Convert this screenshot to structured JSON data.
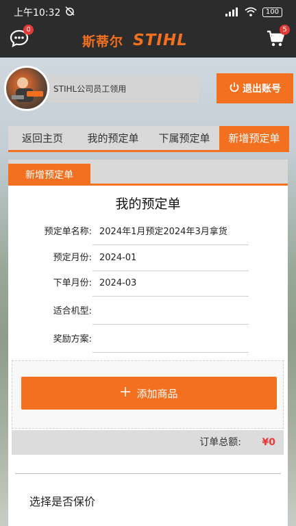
{
  "status_bar": {
    "time": "上午10:32",
    "battery": "100"
  },
  "header": {
    "brand_cn": "斯蒂尔",
    "brand_en": "STIHL",
    "chat_badge": "0",
    "cart_badge": "5"
  },
  "profile": {
    "user_label": "STIHL公司员工领用",
    "logout_label": "退出账号"
  },
  "tabs": [
    {
      "label": "返回主页",
      "active": false
    },
    {
      "label": "我的预定单",
      "active": false
    },
    {
      "label": "下属预定单",
      "active": false
    },
    {
      "label": "新增预定单",
      "active": true
    }
  ],
  "panel": {
    "tab_label": "新增预定单",
    "title": "我的预定单",
    "fields": [
      {
        "label": "预定单名称:",
        "value": "2024年1月预定2024年3月拿货"
      },
      {
        "label": "预定月份:",
        "value": "2024-01"
      },
      {
        "label": "下单月份:",
        "value": "2024-03"
      },
      {
        "label": "适合机型:",
        "value": ""
      },
      {
        "label": "奖励方案:",
        "value": ""
      }
    ],
    "add_button": "添加商品",
    "total_label": "订单总额:",
    "total_value": "¥0",
    "insure_label": "选择是否保价"
  },
  "colors": {
    "accent": "#f37021",
    "dark": "#2c2c2c",
    "price": "#e53935"
  },
  "icons": [
    "chat-icon",
    "cart-icon",
    "power-icon",
    "plus-icon"
  ]
}
